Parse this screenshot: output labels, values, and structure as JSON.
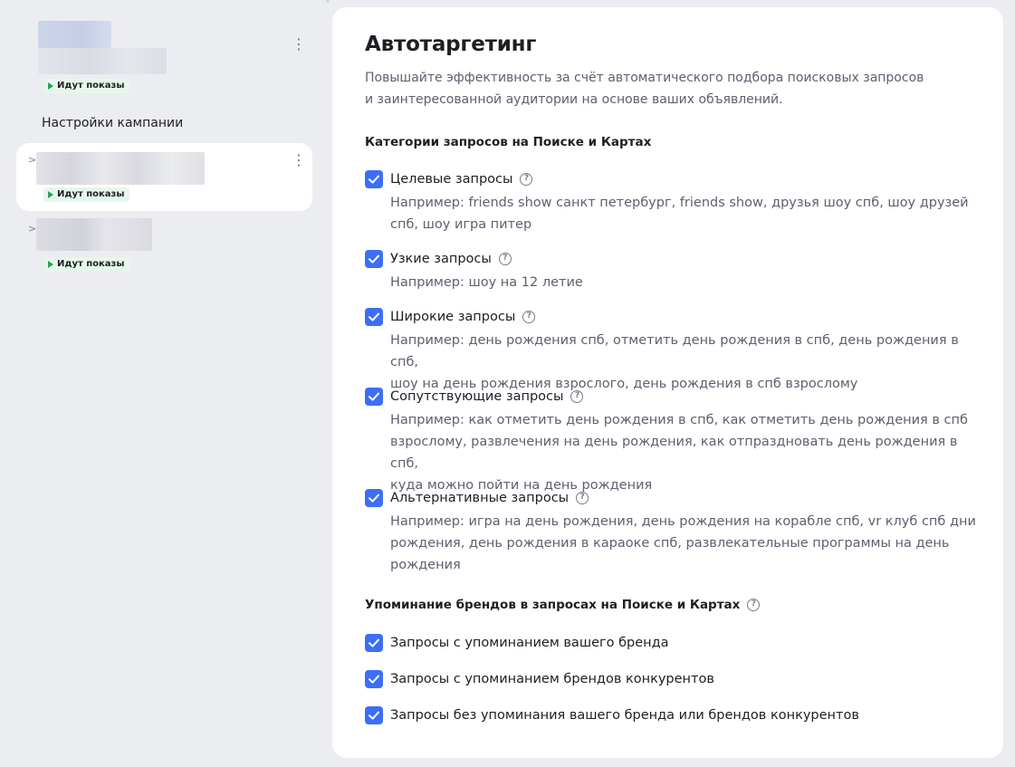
{
  "sidebar": {
    "heading": "Настройки кампании",
    "campaigns": [
      {
        "status": "Идут показы"
      },
      {
        "status": "Идут показы"
      },
      {
        "status": "Идут показы"
      }
    ]
  },
  "autotargeting": {
    "title": "Автотаргетинг",
    "description_line1": "Повышайте эффективность за счёт автоматического подбора поисковых запросов",
    "description_line2": "и заинтересованной аудитории на основе ваших объявлений.",
    "categories_heading": "Категории запросов на Поиске и Картах",
    "categories": [
      {
        "label": "Целевые запросы",
        "checked": true,
        "example_line1": "Например: friends show санкт петербург, friends show, друзья шоу спб, шоу друзей",
        "example_line2": "спб, шоу игра питер"
      },
      {
        "label": "Узкие запросы",
        "checked": true,
        "example_line1": "Например: шоу на 12 летие"
      },
      {
        "label": "Широкие запросы",
        "checked": true,
        "example_line1": "Например: день рождения спб, отметить день рождения в спб, день рождения в спб,",
        "example_line2": "шоу на день рождения взрослого, день рождения в спб взрослому"
      },
      {
        "label": "Сопутствующие запросы",
        "checked": true,
        "example_line1": "Например: как отметить день рождения в спб, как отметить день рождения в спб",
        "example_line2": "взрослому, развлечения на день рождения, как отпраздновать день рождения в спб,",
        "example_line3": "куда можно пойти на день рождения"
      },
      {
        "label": "Альтернативные запросы",
        "checked": true,
        "example_line1": "Например: игра на день рождения, день рождения на корабле спб, vr клуб спб дни",
        "example_line2": "рождения, день рождения в караоке спб, развлекательные программы на день",
        "example_line3": "рождения"
      }
    ],
    "brands_heading": "Упоминание брендов в запросах на Поиске и Картах",
    "brands": [
      {
        "label": "Запросы с упоминанием вашего бренда",
        "checked": true
      },
      {
        "label": "Запросы с упоминанием брендов конкурентов",
        "checked": true
      },
      {
        "label": "Запросы без упоминания вашего бренда или брендов конкурентов",
        "checked": true
      }
    ],
    "help_glyph": "?",
    "accent_color": "#3d6ef6",
    "status_color": "#23a455"
  }
}
